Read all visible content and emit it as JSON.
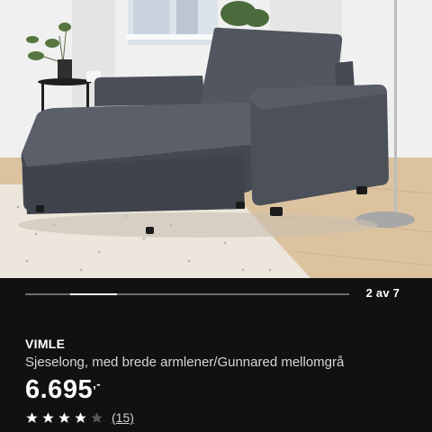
{
  "gallery": {
    "counter": "2 av 7",
    "current_index": 2,
    "total": 7
  },
  "product": {
    "name": "VIMLE",
    "description": "Sjeselong, med brede armlener/Gunnared mellomgrå",
    "price": "6.695",
    "price_suffix": ",-",
    "rating": 4,
    "rating_max": 5,
    "review_count": "(15)"
  },
  "colors": {
    "background": "#111111",
    "sofa": "#4a4e57",
    "wall": "#efefef",
    "floor": "#d9bf9b"
  },
  "icons": [
    "star-icon",
    "star-empty-icon"
  ]
}
